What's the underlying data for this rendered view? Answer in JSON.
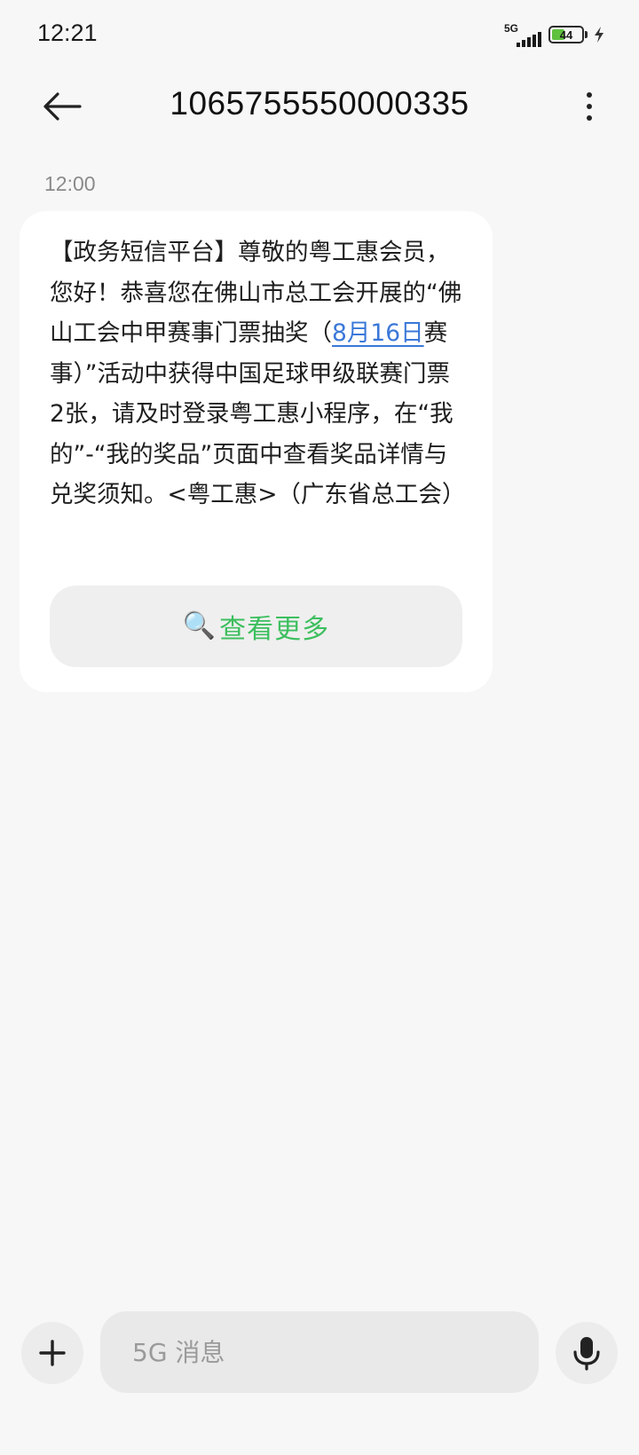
{
  "status_bar": {
    "time": "12:21",
    "network": "5G",
    "battery_level": 44,
    "battery_text": "44",
    "charging": true,
    "battery_color": "#5fc13e"
  },
  "header": {
    "title": "1065755550000335",
    "back_icon": "arrow-left-icon",
    "more_icon": "more-vertical-icon"
  },
  "conversation": {
    "messages": [
      {
        "time": "12:00",
        "text_before_link": "【政务短信平台】尊敬的粤工惠会员，您好！恭喜您在佛山市总工会开展的“佛山工会中甲赛事门票抽奖（",
        "link_text": "8月16日",
        "text_after_link": "赛事）”活动中获得中国足球甲级联赛门票2张，请及时登录粤工惠小程序，在“我的”-“我的奖品”页面中查看奖品详情与兑奖须知。<粤工惠>（广东省总工会）",
        "action_icon": "🔍",
        "action_label": "查看更多"
      }
    ]
  },
  "input_bar": {
    "placeholder": "5G 消息",
    "add_icon": "plus-icon",
    "voice_icon": "microphone-icon"
  },
  "colors": {
    "background": "#f7f7f7",
    "bubble": "#ffffff",
    "link": "#3a78d8",
    "action_text": "#3cbf5e",
    "input_bg": "#e9e9e9"
  }
}
